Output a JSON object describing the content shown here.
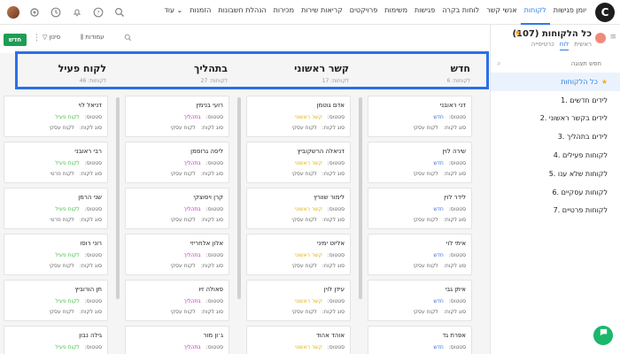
{
  "topnav": {
    "logo": "C",
    "links": [
      "יומן פגישות",
      "לקוחות",
      "אנשי קשר",
      "לוחות בקרה",
      "פגישות",
      "משימות",
      "פרויקטים",
      "קריאות שירות",
      "מכירות",
      "הנהלת חשבונות",
      "הזמנות",
      "עוד"
    ]
  },
  "sidebar": {
    "title": "כל הלקוחות (107)",
    "tabs": [
      "ראשית",
      "לוח",
      "כרטיסייה"
    ],
    "search_placeholder": "חפש תצוגה",
    "items": [
      "כל הלקוחות",
      "1. לידים חדשים",
      "2. לידים בקשר ראשוני",
      "3. לידים בתהליך",
      "4. לקוחות פעילים",
      "5. לקוחות שלא ענו",
      "6. לקוחות עסקיים",
      "7. לקוחות פרטיים"
    ]
  },
  "toolbar": {
    "new_label": "חדש",
    "filter_label": "סינון",
    "columns_label": "עמודות"
  },
  "colors": {
    "new": "#3a6fd8",
    "first_contact": "#e8b400",
    "in_progress": "#c52bc4",
    "active": "#3fbf3f",
    "accent": "#2b7be4"
  },
  "labels": {
    "status": "סטטוס:",
    "type": "סוג לקוח:"
  },
  "columns": [
    {
      "title": "חדש",
      "count": "לקוחות: 6",
      "status_color": "#3a6fd8",
      "cards": [
        {
          "name": "דני ראובני",
          "status": "חדש",
          "type": "לקוח עסקי"
        },
        {
          "name": "שירה לוין",
          "status": "חדש",
          "type": "לקוח עסקי"
        },
        {
          "name": "לידר לוין",
          "status": "חדש",
          "type": "לקוח עסקי"
        },
        {
          "name": "איתי לוי",
          "status": "חדש",
          "type": "לקוח עסקי"
        },
        {
          "name": "איתן גבי",
          "status": "חדש",
          "type": "לקוח עסקי"
        },
        {
          "name": "אפרת גד",
          "status": "חדש",
          "type": "לקוח עסקי"
        }
      ]
    },
    {
      "title": "קשר ראשוני",
      "count": "לקוחות: 17",
      "status_color": "#e8b400",
      "cards": [
        {
          "name": "אדם גוטמן",
          "status": "קשר ראשוני",
          "type": "לקוח עסקי"
        },
        {
          "name": "דניאלה הרשקוביץ",
          "status": "קשר ראשוני",
          "type": "לקוח עסקי"
        },
        {
          "name": "לימור שוורץ",
          "status": "קשר ראשוני",
          "type": "לקוח עסקי"
        },
        {
          "name": "אליוט ימיני",
          "status": "קשר ראשוני",
          "type": "לקוח עסקי"
        },
        {
          "name": "עידן לוין",
          "status": "קשר ראשוני",
          "type": "לקוח עסקי"
        },
        {
          "name": "אוהד אהוד",
          "status": "קשר ראשוני",
          "type": "לקוח עסקי"
        }
      ]
    },
    {
      "title": "בתהליך",
      "count": "לקוחות: 27",
      "status_color": "#c52bc4",
      "cards": [
        {
          "name": "רועי בנימין",
          "status": "בתהליך",
          "type": "לקוח עסקי"
        },
        {
          "name": "ליסה גרוסמן",
          "status": "בתהליך",
          "type": "לקוח עסקי"
        },
        {
          "name": "קרן ויסוצקי",
          "status": "בתהליך",
          "type": "לקוח עסקי"
        },
        {
          "name": "אלון אלחריזי",
          "status": "בתהליך",
          "type": "לקוח עסקי"
        },
        {
          "name": "פאולה זיו",
          "status": "בתהליך",
          "type": "לקוח עסקי"
        },
        {
          "name": "ג׳ון מור",
          "status": "בתהליך",
          "type": "לקוח עסקי"
        }
      ]
    },
    {
      "title": "לקוח פעיל",
      "count": "לקוחות: 46",
      "status_color": "#3fbf3f",
      "cards": [
        {
          "name": "דניאל לוי",
          "status": "לקוח פעיל",
          "type": "לקוח עסקי"
        },
        {
          "name": "רבי ראובני",
          "status": "לקוח פעיל",
          "type": "לקוח פרטי"
        },
        {
          "name": "שני הרמן",
          "status": "לקוח פעיל",
          "type": "לקוח פרטי"
        },
        {
          "name": "רוני רוסו",
          "status": "לקוח פעיל",
          "type": "לקוח עסקי"
        },
        {
          "name": "תן הורוביץ",
          "status": "לקוח פעיל",
          "type": "לקוח עסקי"
        },
        {
          "name": "גילה נבון",
          "status": "לקוח פעיל",
          "type": "לקוח עסקי"
        }
      ]
    }
  ]
}
